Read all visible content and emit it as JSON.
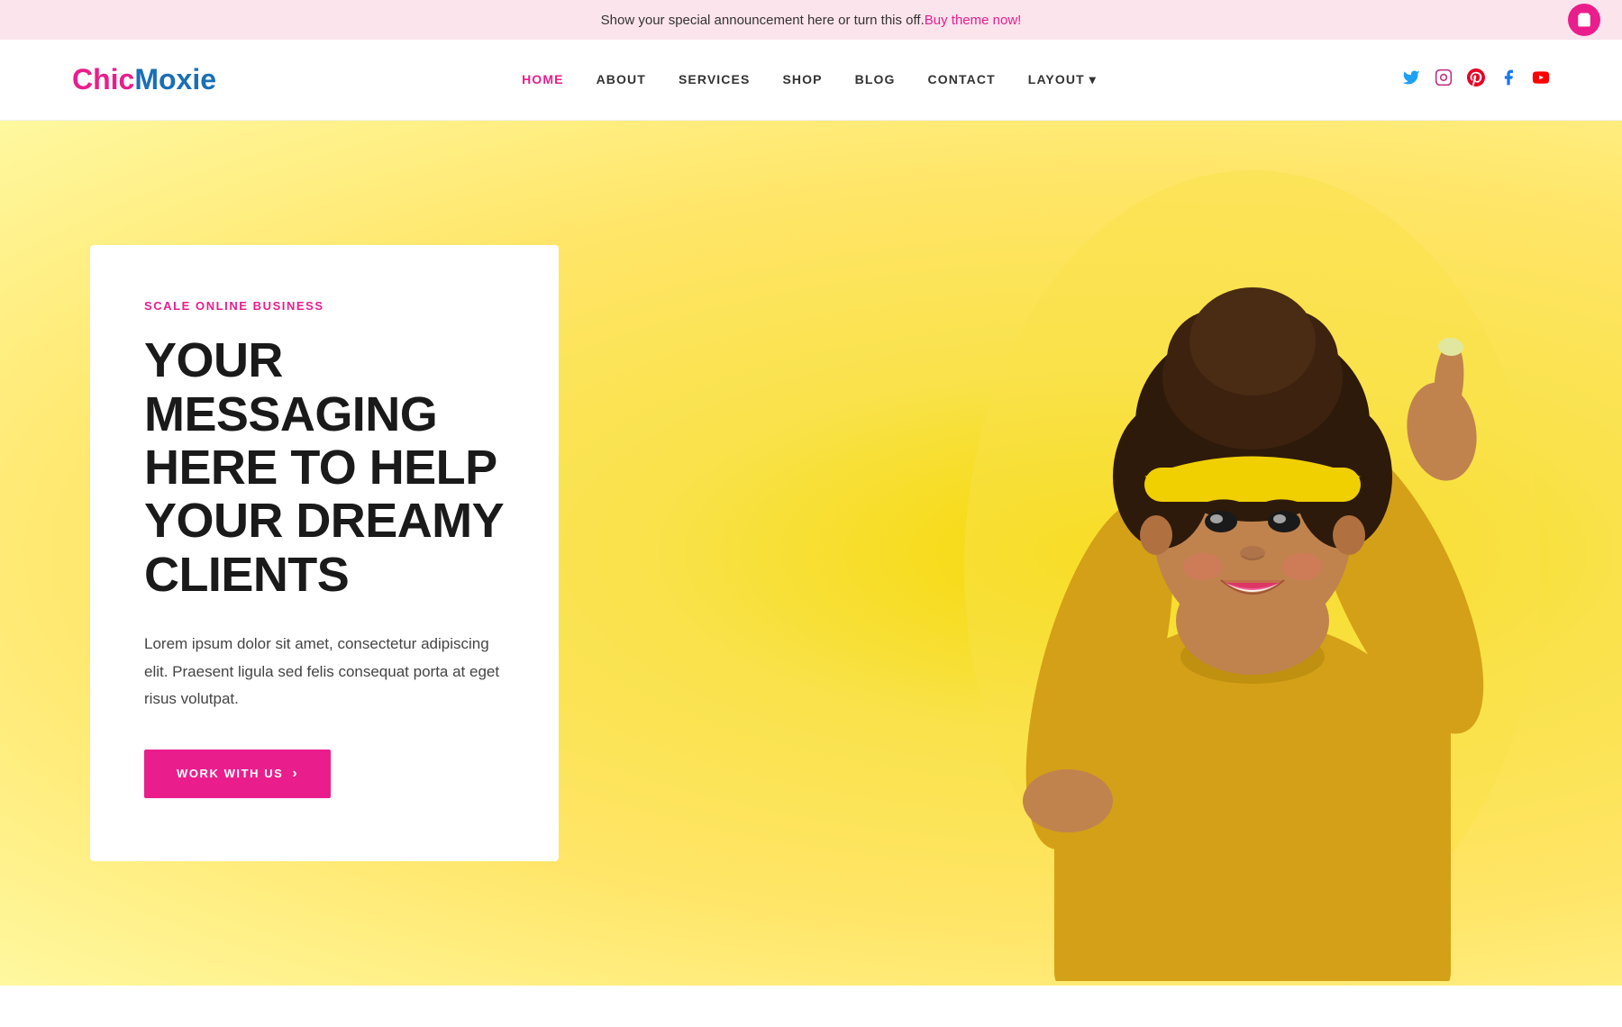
{
  "announcement": {
    "text": "Show your special announcement here or turn this off. ",
    "link_text": "Buy theme now!",
    "link_url": "#"
  },
  "nav": {
    "logo": {
      "chic": "Chic",
      "moxie": "Moxie"
    },
    "links": [
      {
        "label": "HOME",
        "active": true
      },
      {
        "label": "ABOUT",
        "active": false
      },
      {
        "label": "SERVICES",
        "active": false
      },
      {
        "label": "SHOP",
        "active": false
      },
      {
        "label": "BLOG",
        "active": false
      },
      {
        "label": "CONTACT",
        "active": false
      },
      {
        "label": "LAYOUT ▾",
        "active": false
      }
    ],
    "social": [
      {
        "name": "twitter",
        "icon": "𝕏",
        "unicode": "𝕏"
      },
      {
        "name": "instagram",
        "icon": "📷",
        "unicode": "◎"
      },
      {
        "name": "pinterest",
        "icon": "𝕻",
        "unicode": "𝕻"
      },
      {
        "name": "facebook",
        "icon": "𝕗",
        "unicode": "𝕗"
      },
      {
        "name": "youtube",
        "icon": "▶",
        "unicode": "▶"
      }
    ]
  },
  "hero": {
    "subtitle": "SCALE ONLINE BUSINESS",
    "title": "YOUR MESSAGING HERE TO HELP YOUR DREAMY CLIENTS",
    "description": "Lorem ipsum dolor sit amet, consectetur adipiscing elit. Praesent ligula sed felis consequat porta at eget risus volutpat.",
    "cta_label": "WORK WITH US",
    "cta_arrow": "›"
  },
  "colors": {
    "pink": "#e91e8c",
    "blue": "#1a6fb5",
    "yellow": "#f5e642",
    "dark": "#1a1a1a",
    "announcement_bg": "#fce4ec"
  }
}
